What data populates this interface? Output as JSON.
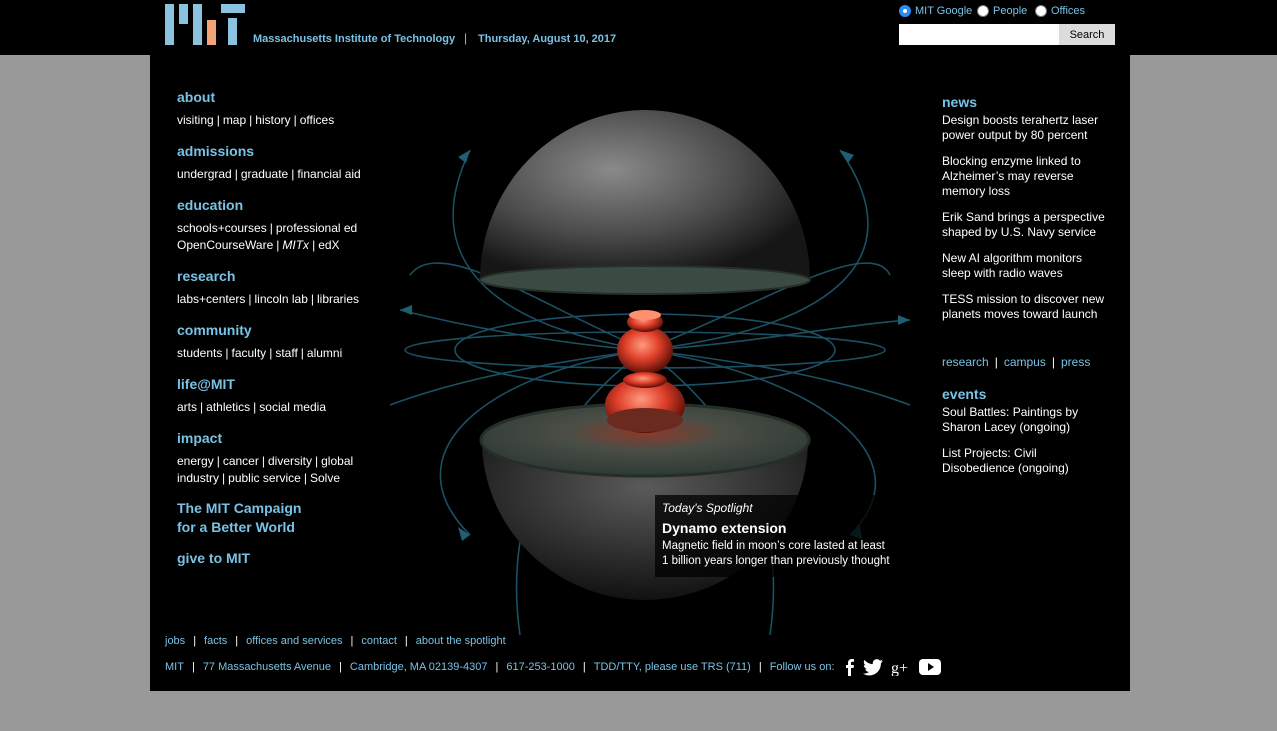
{
  "header": {
    "institute": "Massachusetts Institute of Technology",
    "date": "Thursday, August 10, 2017",
    "search": {
      "options": [
        "MIT Google",
        "People",
        "Offices"
      ],
      "selected": "MIT Google",
      "value": "",
      "button": "Search"
    }
  },
  "nav": [
    {
      "title": "about",
      "rows": [
        [
          "visiting",
          "map",
          "history",
          "offices"
        ]
      ]
    },
    {
      "title": "admissions",
      "rows": [
        [
          "undergrad",
          "graduate",
          "financial aid"
        ]
      ]
    },
    {
      "title": "education",
      "rows": [
        [
          "schools+courses",
          "professional ed"
        ],
        [
          "OpenCourseWare",
          "MITx",
          "edX"
        ]
      ]
    },
    {
      "title": "research",
      "rows": [
        [
          "labs+centers",
          "lincoln lab",
          "libraries"
        ]
      ]
    },
    {
      "title": "community",
      "rows": [
        [
          "students",
          "faculty",
          "staff",
          "alumni"
        ]
      ]
    },
    {
      "title": "life@MIT",
      "rows": [
        [
          "arts",
          "athletics",
          "social media"
        ]
      ]
    },
    {
      "title": "impact",
      "rows": [
        [
          "energy",
          "cancer",
          "diversity",
          "global"
        ],
        [
          "industry",
          "public service",
          "Solve"
        ]
      ]
    }
  ],
  "campaign": {
    "line1": "The MIT Campaign",
    "line2": "for a Better World"
  },
  "give": "give to MIT",
  "news": {
    "title": "news",
    "items": [
      "Design boosts terahertz laser power output by 80 percent",
      "Blocking enzyme linked to Alzheimer’s may reverse memory loss",
      "Erik Sand brings a perspective shaped by U.S. Navy service",
      "New AI algorithm monitors sleep with radio waves",
      "TESS mission to discover new planets moves toward launch"
    ],
    "links": [
      "research",
      "campus",
      "press"
    ]
  },
  "events": {
    "title": "events",
    "items": [
      "Soul Battles: Paintings by Sharon Lacey (ongoing)",
      "List Projects: Civil Disobedience (ongoing)"
    ]
  },
  "spotlight": {
    "label": "Today's Spotlight",
    "title": "Dynamo extension",
    "line1": "Magnetic field in moon’s core lasted at least",
    "line2": "1 billion years longer than previously thought"
  },
  "footer": {
    "row1": [
      "jobs",
      "facts",
      "offices and services",
      "contact",
      "about the spotlight"
    ],
    "row2": [
      "MIT",
      "77 Massachusetts Avenue",
      "Cambridge, MA 02139-4307",
      "617-253-1000",
      "TDD/TTY, please use TRS (711)"
    ],
    "follow": "Follow us on:",
    "social": [
      "facebook-icon",
      "twitter-icon",
      "google-plus-icon",
      "youtube-icon"
    ]
  },
  "colors": {
    "accent": "#79c2e5",
    "logo_accent": "#f2a477",
    "background": "#000000",
    "page": "#999999"
  }
}
